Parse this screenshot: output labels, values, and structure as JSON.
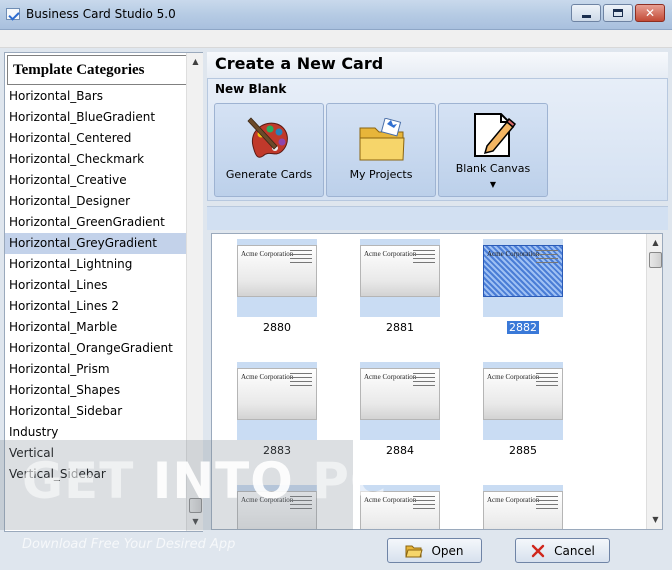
{
  "window": {
    "title": "Business Card Studio 5.0"
  },
  "categories": {
    "header": "Template Categories",
    "items": [
      "Horizontal_Bars",
      "Horizontal_BlueGradient",
      "Horizontal_Centered",
      "Horizontal_Checkmark",
      "Horizontal_Creative",
      "Horizontal_Designer",
      "Horizontal_GreenGradient",
      "Horizontal_GreyGradient",
      "Horizontal_Lightning",
      "Horizontal_Lines",
      "Horizontal_Lines 2",
      "Horizontal_Marble",
      "Horizontal_OrangeGradient",
      "Horizontal_Prism",
      "Horizontal_Shapes",
      "Horizontal_Sidebar",
      "Industry",
      "Vertical",
      "Vertical_Sidebar"
    ],
    "selected_index": 7
  },
  "create": {
    "title": "Create a New Card",
    "section_label": "New Blank",
    "tiles": [
      {
        "label": "Generate Cards",
        "icon": "palette-icon"
      },
      {
        "label": "My Projects",
        "icon": "folder-icon"
      },
      {
        "label": "Blank Canvas",
        "icon": "pencil-paper-icon"
      }
    ]
  },
  "templates": {
    "company_text": "Acme Corporation",
    "cards": [
      {
        "id": "2880",
        "selected": false
      },
      {
        "id": "2881",
        "selected": false
      },
      {
        "id": "2882",
        "selected": true
      },
      {
        "id": "2883",
        "selected": false
      },
      {
        "id": "2884",
        "selected": false
      },
      {
        "id": "2885",
        "selected": false
      },
      {
        "id": "",
        "selected": false
      },
      {
        "id": "",
        "selected": false
      },
      {
        "id": "",
        "selected": false
      }
    ]
  },
  "buttons": {
    "open": "Open",
    "cancel": "Cancel"
  },
  "watermark": {
    "brand_pre": "GET ",
    "brand_mid": "INTO",
    "brand_post": " PC",
    "tagline": "Download Free Your Desired App"
  },
  "colors": {
    "selection": "#c3d2ea",
    "accent": "#3a79d8"
  }
}
